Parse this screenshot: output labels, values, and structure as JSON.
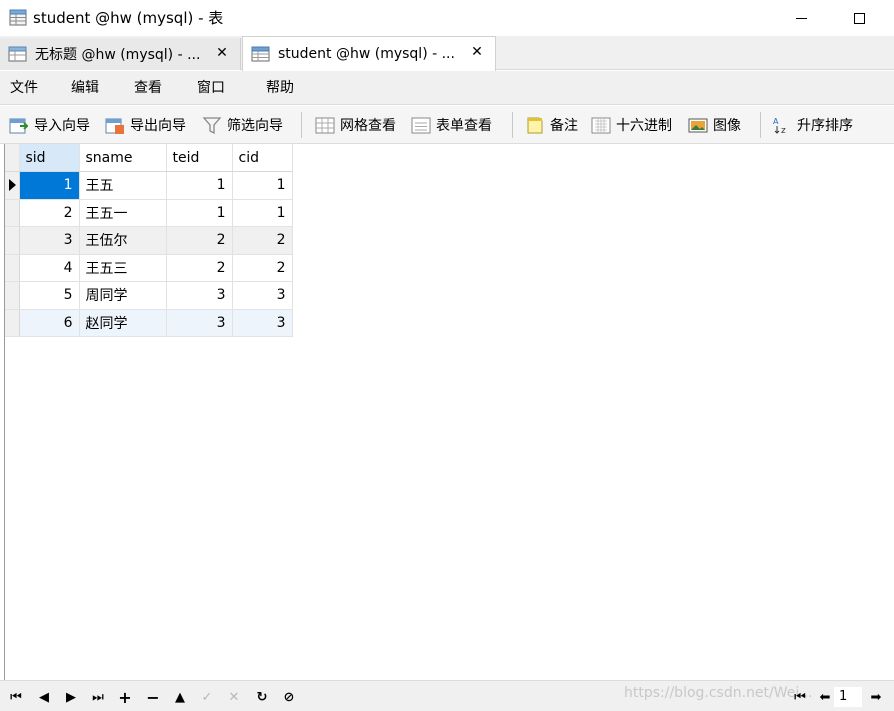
{
  "window": {
    "title": "student @hw (mysql) - 表",
    "icon": "table-window-icon"
  },
  "tabs": [
    {
      "label": "无标题 @hw (mysql) - ...",
      "icon": "query-tab-icon",
      "active": false
    },
    {
      "label": "student @hw (mysql) - ...",
      "icon": "table-tab-icon",
      "active": true
    }
  ],
  "menu": [
    "文件",
    "编辑",
    "查看",
    "窗口",
    "帮助"
  ],
  "toolbar": {
    "import_wizard": "导入向导",
    "export_wizard": "导出向导",
    "filter_wizard": "筛选向导",
    "grid_view": "网格查看",
    "form_view": "表单查看",
    "memo": "备注",
    "hex": "十六进制",
    "image": "图像",
    "sort_asc": "升序排序"
  },
  "grid": {
    "columns": [
      "sid",
      "sname",
      "teid",
      "cid"
    ],
    "rows": [
      {
        "sid": "1",
        "sname": "王五",
        "teid": "1",
        "cid": "1"
      },
      {
        "sid": "2",
        "sname": "王五一",
        "teid": "1",
        "cid": "1"
      },
      {
        "sid": "3",
        "sname": "王伍尔",
        "teid": "2",
        "cid": "2"
      },
      {
        "sid": "4",
        "sname": "王五三",
        "teid": "2",
        "cid": "2"
      },
      {
        "sid": "5",
        "sname": "周同学",
        "teid": "3",
        "cid": "3"
      },
      {
        "sid": "6",
        "sname": "赵同学",
        "teid": "3",
        "cid": "3"
      }
    ]
  },
  "navbar": {
    "watermark": "https://blog.csdn.net/Wei...",
    "page": "1"
  },
  "colors": {
    "selection": "#0078d7",
    "selected_header": "#d7e8f8",
    "alt_row": "#eef4fb"
  }
}
